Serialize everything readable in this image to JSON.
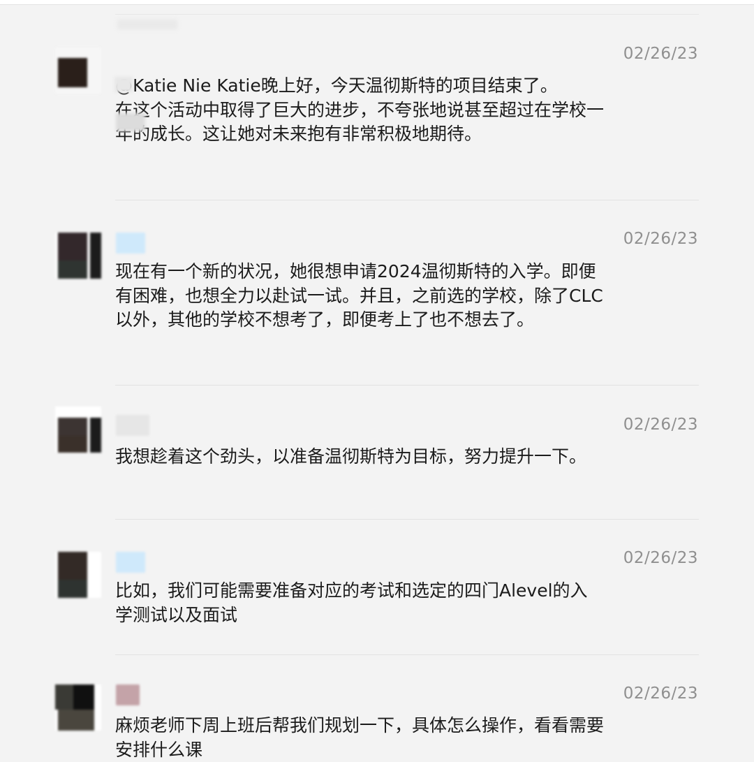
{
  "messages": [
    {
      "date": "02/26/23",
      "text": "@Katie Nie Katie晚上好，今天温彻斯特的项目结束了。  在这个活动中取得了巨大的进步，不夸张地说甚至超过在学校一年的成长。这让她对未来抱有非常积极地期待。"
    },
    {
      "date": "02/26/23",
      "text": "现在有一个新的状况，她很想申请2024温彻斯特的入学。即便有困难，也想全力以赴试一试。并且，之前选的学校，除了CLC以外，其他的学校不想考了，即便考上了也不想去了。"
    },
    {
      "date": "02/26/23",
      "text": "我想趁着这个劲头，以准备温彻斯特为目标，努力提升一下。"
    },
    {
      "date": "02/26/23",
      "text": "比如，我们可能需要准备对应的考试和选定的四门Alevel的入学测试以及面试"
    },
    {
      "date": "02/26/23",
      "text": "麻烦老师下周上班后帮我们规划一下，具体怎么操作，看看需要安排什么课"
    }
  ],
  "colors": {
    "background": "#f3f3f3",
    "text": "#1b1b1b",
    "timestamp": "#8f8f8f",
    "divider": "#e2e2e2"
  }
}
